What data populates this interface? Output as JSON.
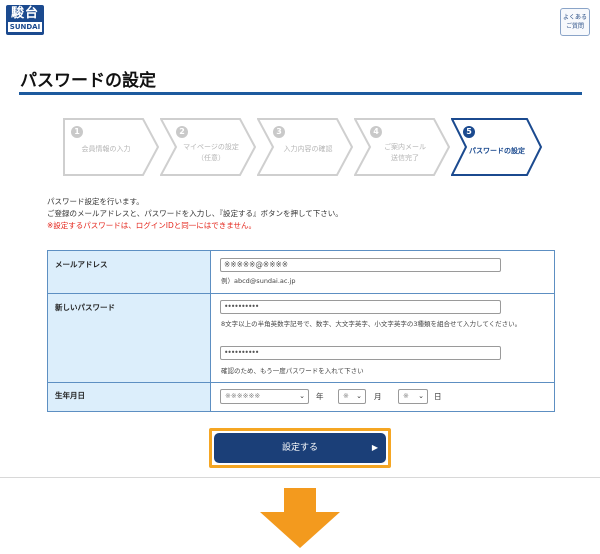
{
  "header": {
    "logo_kanji": "駿台",
    "logo_latin": "SUNDAI",
    "faq_line1": "よくある",
    "faq_line2": "ご質問"
  },
  "page_title": "パスワードの設定",
  "steps": [
    {
      "num": "1",
      "line1": "会員情報の入力",
      "line2": ""
    },
    {
      "num": "2",
      "line1": "マイページの設定",
      "line2": "（任意）"
    },
    {
      "num": "3",
      "line1": "入力内容の確認",
      "line2": ""
    },
    {
      "num": "4",
      "line1": "ご案内メール",
      "line2": "送信完了"
    },
    {
      "num": "5",
      "line1": "パスワードの設定",
      "line2": ""
    }
  ],
  "intro": {
    "line1": "パスワード設定を行います。",
    "line2": "ご登録のメールアドレスと、パスワードを入力し、『設定する』ボタンを押して下さい。",
    "warning": "※設定するパスワードは、ログインIDと同一にはできません。"
  },
  "form": {
    "email": {
      "label": "メールアドレス",
      "value": "※※※※※@※※※※",
      "example": "例）abcd@sundai.ac.jp"
    },
    "new_password": {
      "label": "新しいパスワード",
      "value": "••••••••••",
      "hint": "8文字以上の半角英数字記号で、数字、大文字英字、小文字英字の3種類を組合せて入力してください。",
      "confirm_value": "••••••••••",
      "confirm_hint": "確認のため、もう一度パスワードを入れて下さい"
    },
    "birthdate": {
      "label": "生年月日",
      "year_value": "※※※※※※",
      "year_unit": "年",
      "month_value": "※",
      "month_unit": "月",
      "day_value": "※",
      "day_unit": "日"
    }
  },
  "submit_label": "設定する",
  "colors": {
    "brand": "#1b4a8f",
    "highlight": "#f5a623",
    "warning": "#e4261c",
    "arrow": "#f39a1e"
  }
}
